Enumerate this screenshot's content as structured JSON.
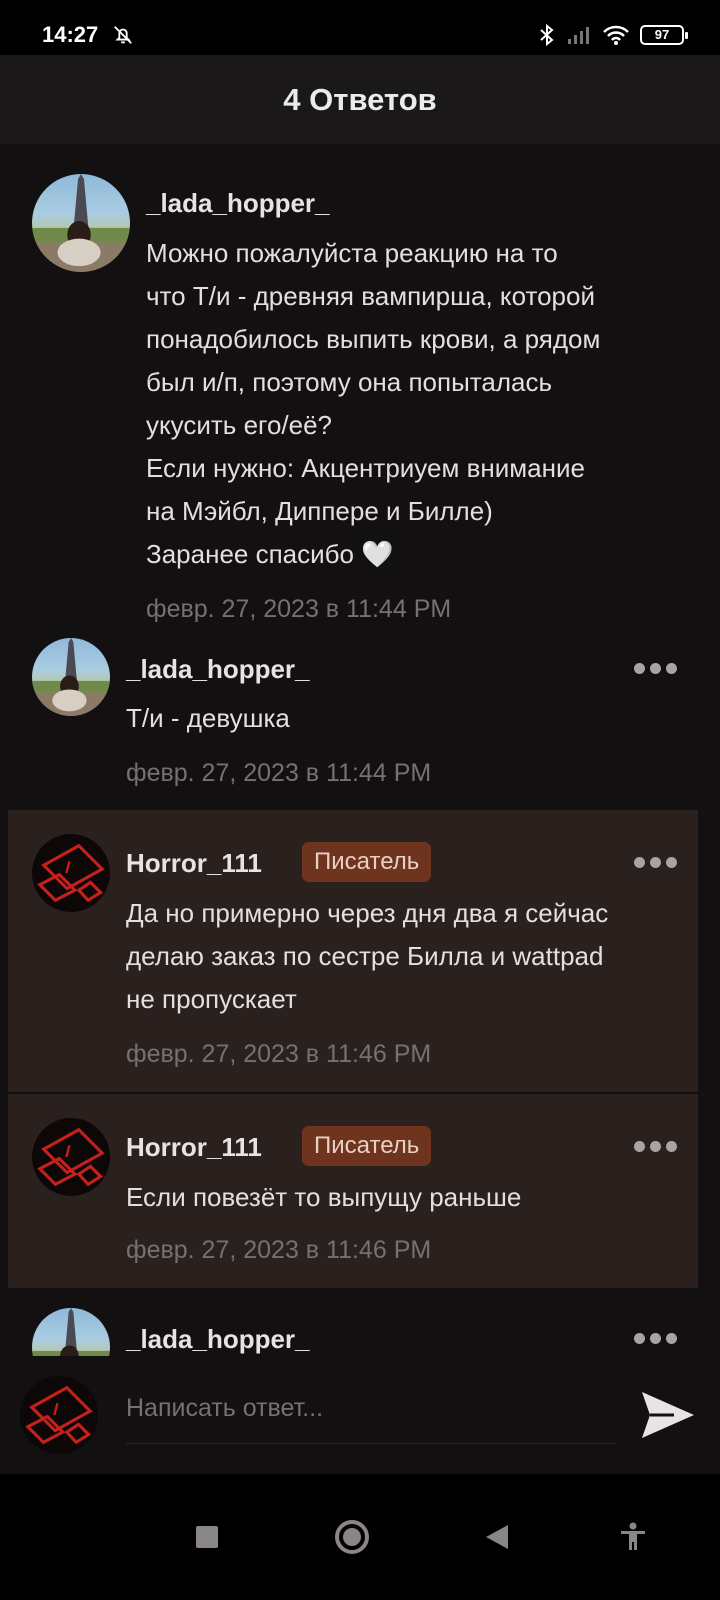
{
  "status_bar": {
    "time": "14:27",
    "battery": "97"
  },
  "header": {
    "title": "4 Ответов"
  },
  "main_comment": {
    "username": "_lada_hopper_",
    "text_lines": [
      "Можно пожалуйста реакцию на то",
      "что Т/и - древняя вампирша, которой",
      "понадобилось выпить крови, а рядом",
      "был и/п, поэтому она попыталась",
      "укусить его/её?",
      "Если нужно: Акцентриуем внимание",
      "на Мэйбл, Диппере и Билле)",
      "Заранее спасибо 🤍"
    ],
    "timestamp": "февр. 27, 2023 в 11:44 PM"
  },
  "replies": [
    {
      "username": "_lada_hopper_",
      "badge": "",
      "text_lines": [
        "Т/и - девушка"
      ],
      "timestamp": "февр. 27, 2023 в 11:44 PM"
    },
    {
      "username": "Horror_111",
      "badge": "Писатель",
      "text_lines": [
        "Да но примерно через дня два я сейчас",
        "делаю заказ по сестре Билла и wattpad",
        "не пропускает"
      ],
      "timestamp": "февр. 27, 2023 в 11:46 PM"
    },
    {
      "username": "Horror_111",
      "badge": "Писатель",
      "text_lines": [
        "Если повезёт то выпущу раньше"
      ],
      "timestamp": "февр. 27, 2023 в 11:46 PM"
    },
    {
      "username": "_lada_hopper_",
      "badge": "",
      "text_lines": [],
      "timestamp": ""
    }
  ],
  "composer": {
    "placeholder": "Написать ответ..."
  },
  "icons": {
    "mute": "bell-off-icon",
    "more": "more-dots-icon",
    "send": "send-icon",
    "nav": [
      "square-icon",
      "circle-icon",
      "back-triangle-icon",
      "accessibility-icon"
    ]
  },
  "colors": {
    "background": "#121011",
    "header": "#1a1819",
    "highlight_reply": "#2a201e",
    "badge": "#6f341e",
    "timestamp": "#77706f"
  }
}
